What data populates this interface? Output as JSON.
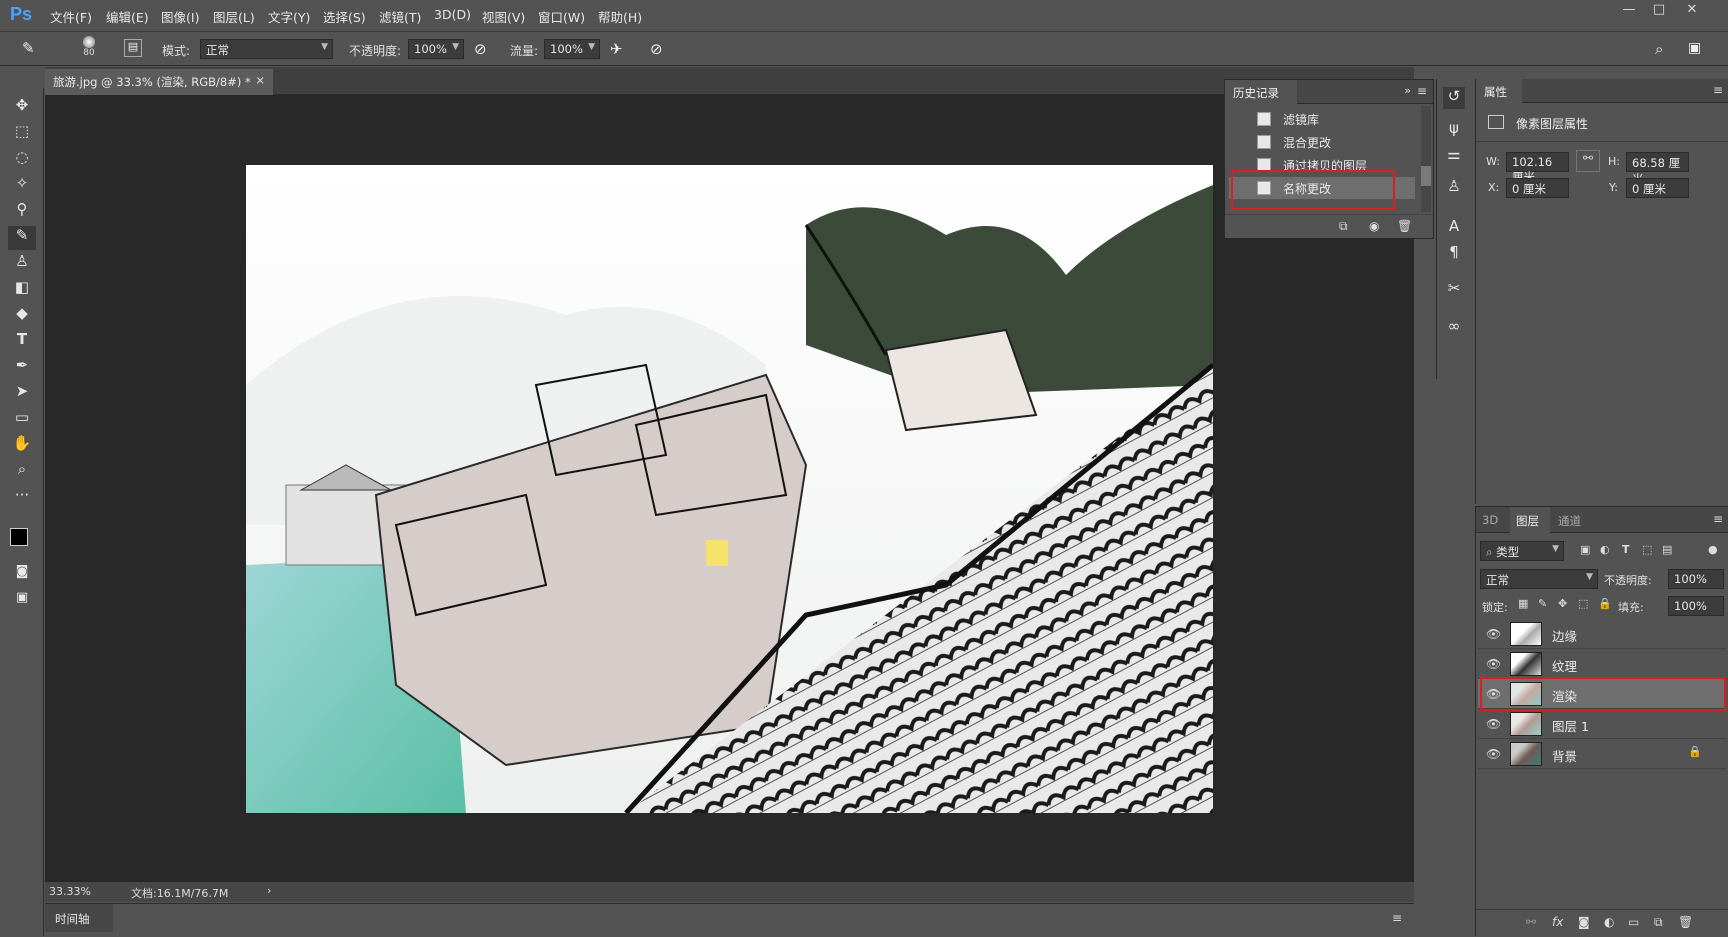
{
  "menubar": {
    "logo": "Ps",
    "items": [
      "文件(F)",
      "编辑(E)",
      "图像(I)",
      "图层(L)",
      "文字(Y)",
      "选择(S)",
      "滤镜(T)",
      "3D(D)",
      "视图(V)",
      "窗口(W)",
      "帮助(H)"
    ],
    "window_controls": [
      "—",
      "□",
      "✕"
    ]
  },
  "options": {
    "brush_size": "80",
    "mode_label": "模式:",
    "mode_value": "正常",
    "opacity_label": "不透明度:",
    "opacity_value": "100%",
    "flow_label": "流量:",
    "flow_value": "100%"
  },
  "document": {
    "tab_title": "旅游.jpg @ 33.3% (渲染, RGB/8#) *",
    "close": "×",
    "zoom": "33.33%",
    "doc_info": "文档:16.1M/76.7M"
  },
  "timeline": {
    "label": "时间轴"
  },
  "history": {
    "title": "历史记录",
    "items": [
      "滤镜库",
      "混合更改",
      "通过拷贝的图层",
      "名称更改"
    ]
  },
  "properties": {
    "title": "属性",
    "subtitle": "像素图层属性",
    "w_label": "W:",
    "w_value": "102.16 厘米",
    "h_label": "H:",
    "h_value": "68.58 厘米",
    "x_label": "X:",
    "x_value": "0 厘米",
    "y_label": "Y:",
    "y_value": "0 厘米"
  },
  "layers_panel": {
    "tabs": [
      "3D",
      "图层",
      "通道"
    ],
    "filter_kind": "类型",
    "blend_mode": "正常",
    "opacity_label": "不透明度:",
    "opacity_value": "100%",
    "lock_label": "锁定:",
    "fill_label": "填充:",
    "fill_value": "100%",
    "layers": [
      {
        "name": "边缘"
      },
      {
        "name": "纹理"
      },
      {
        "name": "渲染"
      },
      {
        "name": "图层 1"
      },
      {
        "name": "背景"
      }
    ]
  },
  "colors": {
    "highlight": "#d81f26",
    "selected_layer": "#6e6e6e",
    "ps_blue": "#4aa3ff"
  }
}
